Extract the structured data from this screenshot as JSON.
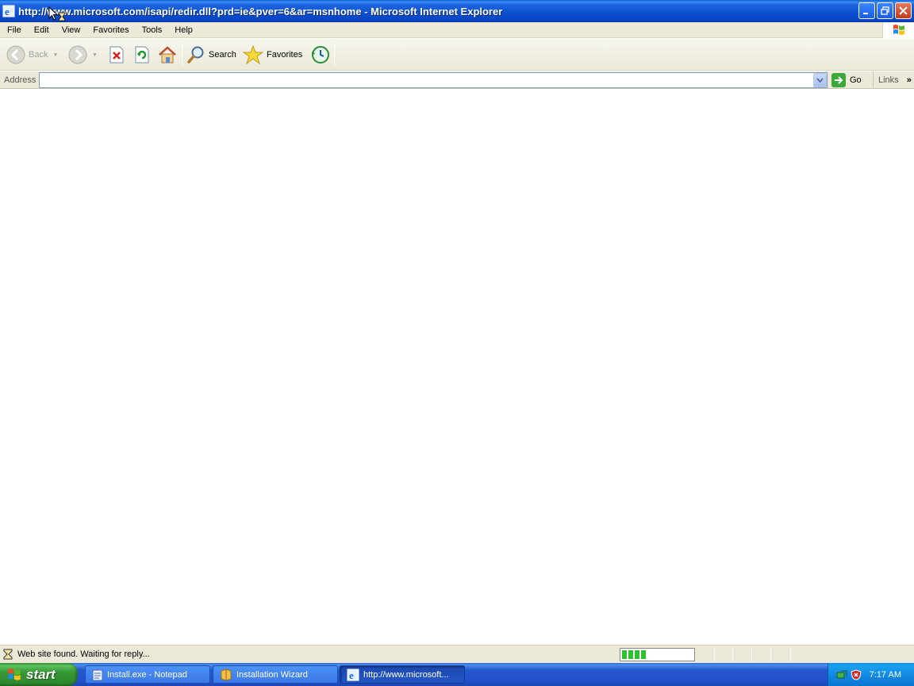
{
  "window": {
    "title": "http://www.microsoft.com/isapi/redir.dll?prd=ie&pver=6&ar=msnhome - Microsoft Internet Explorer"
  },
  "menubar": {
    "items": [
      "File",
      "Edit",
      "View",
      "Favorites",
      "Tools",
      "Help"
    ]
  },
  "toolbar": {
    "back_label": "Back",
    "search_label": "Search",
    "favorites_label": "Favorites"
  },
  "addressbar": {
    "label": "Address",
    "value": "",
    "go_label": "Go",
    "links_label": "Links"
  },
  "statusbar": {
    "text": "Web site found. Waiting for reply...",
    "progress_segments": 4
  },
  "taskbar": {
    "start_label": "start",
    "tasks": [
      {
        "label": "Install.exe - Notepad",
        "active": false
      },
      {
        "label": "Installation Wizard",
        "active": false
      },
      {
        "label": "http://www.microsoft...",
        "active": true
      }
    ],
    "clock": "7:17 AM"
  },
  "colors": {
    "titlebar": "#0a4fd0",
    "start_green": "#379837",
    "chrome_beige": "#ece9d8",
    "taskbar_blue": "#2458d0"
  }
}
